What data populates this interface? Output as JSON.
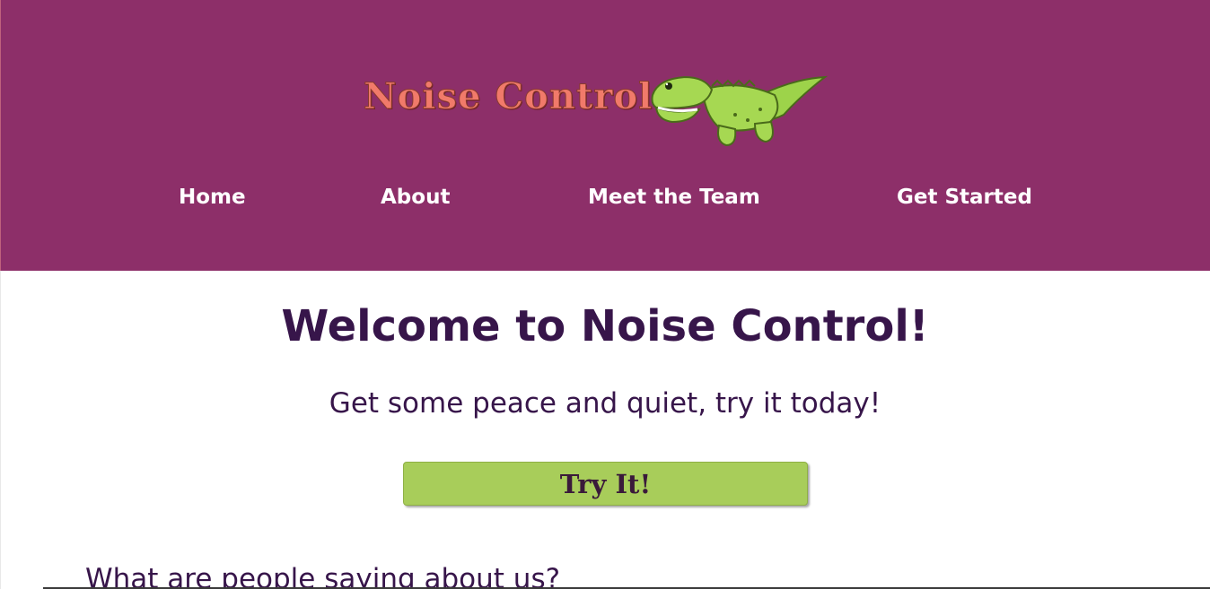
{
  "brand": {
    "logo_text": "Noise Control",
    "mascot_icon": "crocodile-icon",
    "header_color": "#8d2f69",
    "logo_color": "#f17a6a"
  },
  "nav": {
    "items": [
      {
        "label": "Home"
      },
      {
        "label": "About"
      },
      {
        "label": "Meet the Team"
      },
      {
        "label": "Get Started"
      }
    ]
  },
  "hero": {
    "title": "Welcome to Noise Control!",
    "subtitle": "Get some peace and quiet, try it today!",
    "cta_label": "Try It!",
    "cta_color": "#a8cd5a",
    "text_color": "#37154a"
  },
  "testimonials": {
    "heading": "What are people saying about us?"
  }
}
